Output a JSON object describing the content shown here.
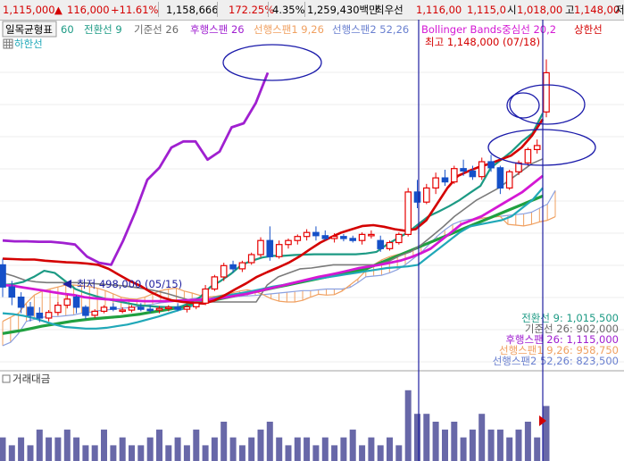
{
  "header": {
    "price": "1,115,000",
    "change_arrow": "▲",
    "change": "116,000",
    "change_pct": "+11.61%",
    "volume": "1,158,666",
    "vol_ratio": "172.25%",
    "turnover_pct": "4.35%",
    "amount": "1,259,430백만",
    "min_label": "최우선",
    "bid_ask": "1,116,00",
    "bid2": "1,115,0",
    "open_label": "시",
    "open": "1,018,00",
    "high_label": "고",
    "high": "1,148,00",
    "tail": "저"
  },
  "legend": {
    "ichimoku_btn": "일목균형표",
    "ichimoku_period": "60",
    "tenkan": "전환선 9",
    "kijun": "기준선 26",
    "chikou": "후행스팬 26",
    "span1": "선행스팬1 9,26",
    "span2": "선행스팬2 52,26",
    "bollinger": "Bollinger Bands중심선 20,2",
    "upper": "상한선",
    "sub": "하한선"
  },
  "annotations": {
    "high": "최고 1,148,000 (07/18)",
    "low": "최저 498,000 (05/15)"
  },
  "values": {
    "tenkan": "전환선 9: 1,015,500",
    "kijun": "기준선 26: 902,000",
    "chikou": "후행스팬 26: 1,115,000",
    "span1": "선행스팬1 9,26: 958,750",
    "span2": "선행스팬2 52,26: 823,500"
  },
  "volume_panel": {
    "title": "거래대금"
  },
  "colors": {
    "up": "#e60000",
    "down": "#1550c8",
    "tenkan": "#1c9a84",
    "kijun": "#7a7a7a",
    "chikou": "#a020d0",
    "span1": "#f0a060",
    "span2": "#8aa0e0",
    "bb_upper": "#d40000",
    "bb_mid": "#d418d4",
    "bb_lower": "#20a8b8",
    "trend": "#20a040",
    "cloud": "#f0a060",
    "volume": "#6868a8",
    "marker": "#2020a0"
  },
  "chart_data": {
    "type": "candlestick",
    "unit": "KRW (thousands)",
    "candles": [
      [
        640,
        655,
        560,
        585
      ],
      [
        585,
        600,
        540,
        560
      ],
      [
        560,
        572,
        520,
        535
      ],
      [
        535,
        548,
        500,
        515
      ],
      [
        520,
        535,
        498,
        508
      ],
      [
        508,
        528,
        500,
        522
      ],
      [
        522,
        548,
        515,
        540
      ],
      [
        540,
        565,
        532,
        555
      ],
      [
        560,
        565,
        520,
        535
      ],
      [
        535,
        540,
        505,
        515
      ],
      [
        515,
        530,
        508,
        525
      ],
      [
        525,
        540,
        520,
        535
      ],
      [
        535,
        545,
        525,
        530
      ],
      [
        525,
        535,
        520,
        528
      ],
      [
        528,
        540,
        522,
        535
      ],
      [
        535,
        545,
        525,
        530
      ],
      [
        530,
        540,
        520,
        528
      ],
      [
        528,
        538,
        520,
        532
      ],
      [
        532,
        540,
        525,
        535
      ],
      [
        535,
        545,
        525,
        530
      ],
      [
        530,
        542,
        522,
        536
      ],
      [
        536,
        548,
        530,
        545
      ],
      [
        545,
        590,
        540,
        580
      ],
      [
        580,
        615,
        575,
        610
      ],
      [
        610,
        645,
        600,
        638
      ],
      [
        640,
        650,
        620,
        630
      ],
      [
        630,
        650,
        622,
        645
      ],
      [
        645,
        670,
        640,
        665
      ],
      [
        665,
        708,
        658,
        700
      ],
      [
        700,
        735,
        650,
        660
      ],
      [
        660,
        700,
        655,
        690
      ],
      [
        690,
        705,
        680,
        700
      ],
      [
        700,
        715,
        690,
        710
      ],
      [
        710,
        728,
        700,
        720
      ],
      [
        720,
        735,
        700,
        712
      ],
      [
        712,
        725,
        700,
        705
      ],
      [
        705,
        718,
        695,
        710
      ],
      [
        710,
        716,
        698,
        705
      ],
      [
        705,
        712,
        695,
        700
      ],
      [
        700,
        720,
        690,
        715
      ],
      [
        715,
        725,
        705,
        715
      ],
      [
        700,
        712,
        672,
        680
      ],
      [
        680,
        700,
        675,
        695
      ],
      [
        695,
        720,
        690,
        715
      ],
      [
        715,
        830,
        710,
        820
      ],
      [
        820,
        850,
        780,
        795
      ],
      [
        795,
        840,
        790,
        830
      ],
      [
        830,
        868,
        815,
        855
      ],
      [
        855,
        875,
        835,
        845
      ],
      [
        845,
        885,
        840,
        878
      ],
      [
        878,
        900,
        860,
        872
      ],
      [
        872,
        885,
        850,
        858
      ],
      [
        858,
        905,
        850,
        895
      ],
      [
        895,
        912,
        870,
        880
      ],
      [
        880,
        885,
        815,
        830
      ],
      [
        830,
        875,
        825,
        870
      ],
      [
        870,
        898,
        862,
        892
      ],
      [
        892,
        930,
        885,
        925
      ],
      [
        925,
        950,
        915,
        935
      ],
      [
        1018,
        1148,
        1005,
        1115
      ]
    ],
    "volume": [
      3,
      2,
      3,
      2,
      4,
      3,
      3,
      4,
      3,
      2,
      2,
      4,
      2,
      3,
      2,
      2,
      3,
      4,
      2,
      3,
      2,
      4,
      2,
      3,
      5,
      3,
      2,
      3,
      4,
      5,
      3,
      2,
      3,
      3,
      2,
      3,
      2,
      3,
      4,
      2,
      3,
      2,
      3,
      2,
      9,
      6,
      6,
      5,
      4,
      5,
      3,
      4,
      6,
      4,
      4,
      3,
      4,
      5,
      3,
      7
    ],
    "tenkan": [
      590,
      592,
      598,
      610,
      625,
      620,
      600,
      580,
      570,
      562,
      555,
      550,
      545,
      540,
      538,
      536,
      535,
      535,
      545,
      560,
      585,
      600,
      618,
      640,
      650,
      658,
      662,
      662,
      664,
      665,
      666,
      666,
      666,
      666,
      666,
      668,
      672,
      690,
      705,
      720,
      740,
      760,
      772,
      785,
      800,
      818,
      835,
      880,
      900,
      920,
      945,
      965,
      1015
    ],
    "kijun": [
      620,
      612,
      602,
      598,
      596,
      596,
      596,
      596,
      594,
      592,
      590,
      588,
      584,
      580,
      575,
      568,
      560,
      552,
      548,
      548,
      548,
      548,
      548,
      548,
      590,
      610,
      620,
      630,
      632,
      636,
      640,
      640,
      640,
      640,
      640,
      648,
      662,
      672,
      690,
      712,
      735,
      760,
      780,
      800,
      815,
      830,
      850,
      870,
      890,
      902
    ],
    "chikou": [
      700,
      698,
      698,
      697,
      697,
      694,
      690,
      660,
      645,
      640,
      700,
      770,
      850,
      880,
      930,
      945,
      945,
      900,
      920,
      980,
      990,
      1040,
      1115
    ],
    "span1": [
      500,
      510,
      520,
      545,
      565,
      575,
      580,
      585,
      590,
      590,
      588,
      586,
      582,
      576,
      568,
      560,
      556,
      555,
      560,
      568,
      576,
      580,
      582,
      575,
      570,
      564,
      560,
      562,
      566,
      570,
      575,
      578,
      574,
      566,
      556,
      550,
      548,
      548,
      552,
      560,
      567,
      565,
      566,
      575,
      590,
      605,
      625,
      640,
      652,
      660,
      665,
      670,
      678,
      686,
      692,
      700,
      710,
      722,
      740,
      748,
      752,
      756,
      758,
      760,
      740,
      738,
      736,
      740,
      746,
      750,
      758.75
    ],
    "span2": [
      440,
      448,
      470,
      500,
      505,
      510,
      512,
      512,
      514,
      516,
      520,
      522,
      526,
      528,
      530,
      532,
      534,
      536,
      540,
      542,
      546,
      548,
      550,
      552,
      556,
      558,
      560,
      562,
      562,
      562,
      562,
      563,
      564,
      566,
      568,
      570,
      572,
      574,
      576,
      576,
      578,
      580,
      580,
      580,
      584,
      596,
      610,
      612,
      614,
      620,
      628,
      640,
      655,
      670,
      690,
      710,
      726,
      740,
      748,
      752,
      754,
      756,
      758,
      760,
      762,
      764,
      766,
      770,
      780,
      790,
      823.5
    ],
    "bb_upper": [
      655,
      654,
      653,
      653,
      650,
      648,
      646,
      645,
      643,
      640,
      630,
      615,
      600,
      588,
      572,
      560,
      552,
      548,
      546,
      544,
      552,
      565,
      580,
      594,
      610,
      622,
      633,
      645,
      660,
      678,
      695,
      708,
      720,
      728,
      736,
      738,
      734,
      728,
      724,
      728,
      750,
      790,
      830,
      860,
      872,
      882,
      890,
      900,
      910,
      930,
      960,
      1000
    ],
    "bb_mid": [
      590,
      588,
      584,
      580,
      576,
      572,
      568,
      565,
      560,
      557,
      555,
      553,
      552,
      551,
      550,
      550,
      550,
      551,
      552,
      553,
      554,
      556,
      560,
      564,
      568,
      574,
      580,
      586,
      592,
      598,
      604,
      610,
      615,
      620,
      626,
      632,
      636,
      640,
      645,
      650,
      658,
      668,
      680,
      700,
      720,
      740,
      750,
      760,
      775,
      790,
      805,
      820,
      840,
      860
    ],
    "bb_lower": [
      520,
      518,
      514,
      508,
      500,
      492,
      486,
      484,
      482,
      482,
      484,
      488,
      492,
      498,
      505,
      512,
      520,
      528,
      536,
      548,
      556,
      562,
      566,
      570,
      575,
      580,
      586,
      590,
      596,
      600,
      604,
      608,
      612,
      616,
      620,
      624,
      628,
      632,
      634,
      636,
      640,
      660,
      680,
      700,
      720,
      735,
      740,
      745,
      750,
      760,
      780,
      800,
      830
    ],
    "trend": [
      470,
      474,
      478,
      483,
      488,
      492,
      496,
      500,
      503,
      506,
      508,
      510,
      512,
      515,
      518,
      522,
      526,
      530,
      535,
      540,
      545,
      550,
      555,
      560,
      565,
      570,
      575,
      580,
      585,
      590,
      595,
      600,
      605,
      610,
      615,
      620,
      625,
      630,
      640,
      650,
      660,
      670,
      680,
      690,
      700,
      710,
      720,
      730,
      740,
      750,
      760,
      770,
      780,
      790,
      800,
      810
    ],
    "high_label": "최고 1,148,000 (07/18)",
    "low_label": "최저 498,000 (05/15)"
  }
}
